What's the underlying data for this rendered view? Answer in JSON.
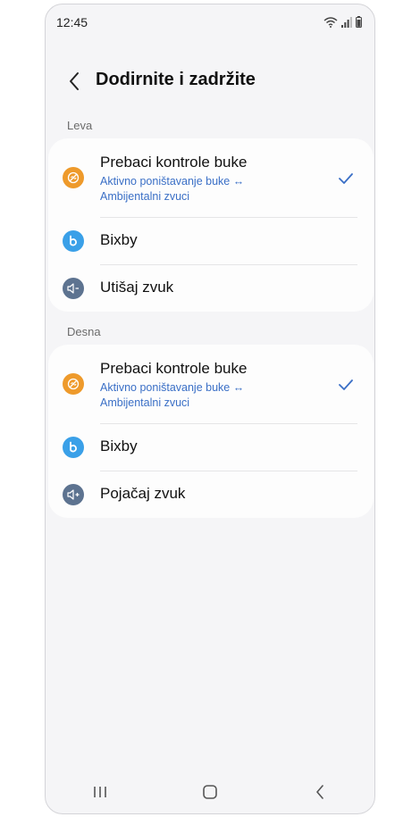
{
  "status": {
    "time": "12:45"
  },
  "header": {
    "title": "Dodirnite i zadržite"
  },
  "left": {
    "label": "Leva",
    "items": [
      {
        "title": "Prebaci kontrole buke",
        "sub1": "Aktivno poništavanje buke ↔",
        "sub2": "Ambijentalni zvuci",
        "icon": "noise-control-icon",
        "selected": true
      },
      {
        "title": "Bixby",
        "icon": "bixby-icon"
      },
      {
        "title": "Utišaj zvuk",
        "icon": "volume-down-icon"
      }
    ]
  },
  "right": {
    "label": "Desna",
    "items": [
      {
        "title": "Prebaci kontrole buke",
        "sub1": "Aktivno poništavanje buke ↔",
        "sub2": "Ambijentalni zvuci",
        "icon": "noise-control-icon",
        "selected": true
      },
      {
        "title": "Bixby",
        "icon": "bixby-icon"
      },
      {
        "title": "Pojačaj zvuk",
        "icon": "volume-up-icon"
      }
    ]
  },
  "colors": {
    "accent": "#3a6fc6",
    "noise_icon": "#ee9a2b",
    "bixby_icon": "#3aa0e8",
    "volume_icon": "#5d7390",
    "background": "#f5f5f7"
  }
}
